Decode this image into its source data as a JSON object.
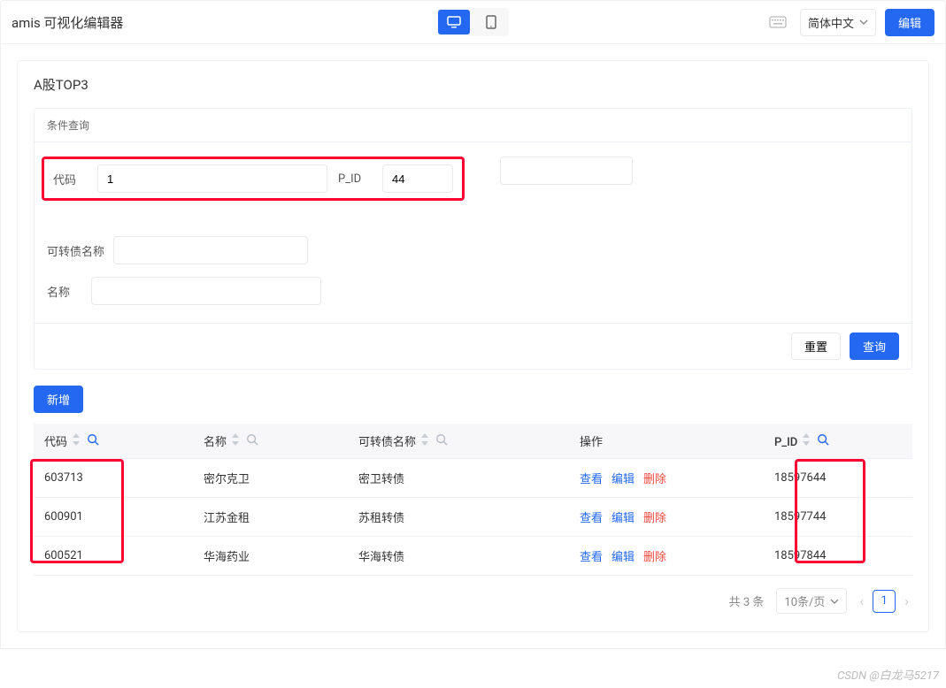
{
  "topbar": {
    "title": "amis 可视化编辑器",
    "lang_label": "简体中文",
    "edit_label": "编辑"
  },
  "page": {
    "title": "A股TOP3"
  },
  "filter": {
    "title": "条件查询",
    "code_label": "代码",
    "code_value": "1",
    "pid_label": "P_ID",
    "pid_value": "44",
    "bond_label": "可转债名称",
    "bond_value": "",
    "name_label": "名称",
    "name_value": "",
    "reset_label": "重置",
    "search_label": "查询"
  },
  "toolbar": {
    "add_label": "新增"
  },
  "table": {
    "columns": {
      "code": "代码",
      "name": "名称",
      "bond": "可转债名称",
      "ops": "操作",
      "pid": "P_ID"
    },
    "ops": {
      "view": "查看",
      "edit": "编辑",
      "delete": "删除"
    },
    "rows": [
      {
        "code": "603713",
        "name": "密尔克卫",
        "bond": "密卫转债",
        "pid": "18597644"
      },
      {
        "code": "600901",
        "name": "江苏金租",
        "bond": "苏租转债",
        "pid": "18597744"
      },
      {
        "code": "600521",
        "name": "华海药业",
        "bond": "华海转债",
        "pid": "18597844"
      }
    ]
  },
  "pager": {
    "total_text": "共 3 条",
    "page_size_label": "10条/页",
    "current": "1"
  },
  "watermark": "CSDN @白龙马5217"
}
